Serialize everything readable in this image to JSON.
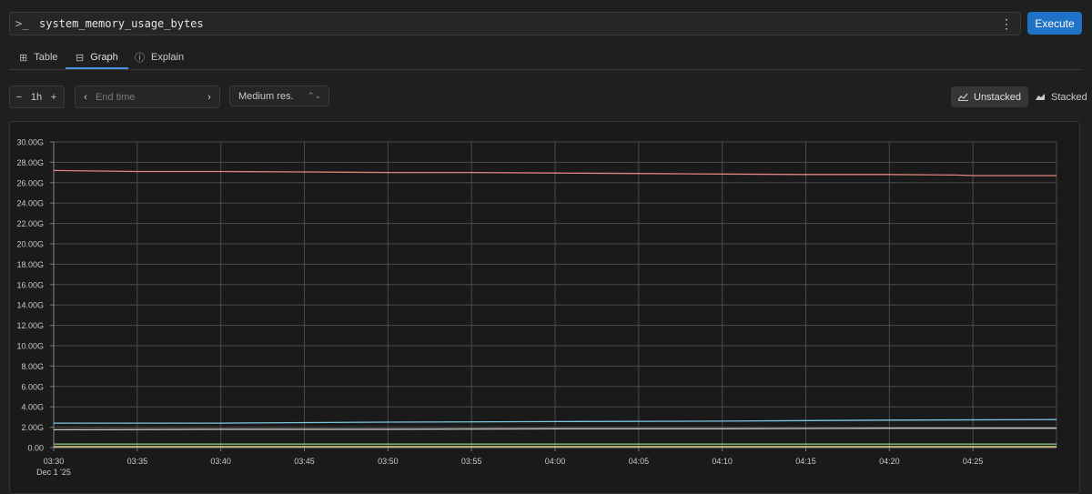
{
  "query": {
    "prompt_icon": "terminal-prompt-icon",
    "prompt_glyph": ">_",
    "expression": "system_memory_usage_bytes",
    "more_icon": "kebab-menu-icon",
    "execute_label": "Execute"
  },
  "tabs": [
    {
      "label": "Table",
      "icon": "table-icon",
      "active": false
    },
    {
      "label": "Graph",
      "icon": "graph-icon",
      "active": true
    },
    {
      "label": "Explain",
      "icon": "info-icon",
      "active": false
    }
  ],
  "controls": {
    "range_minus": "−",
    "range_value": "1h",
    "range_plus": "+",
    "end_prev": "‹",
    "end_time_placeholder": "End time",
    "end_next": "›",
    "resolution": "Medium res.",
    "unstacked_label": "Unstacked",
    "stacked_label": "Stacked",
    "selected_mode": "Unstacked"
  },
  "colors": {
    "accent": "#1f72c7",
    "grid": "#4a4a4a"
  },
  "chart_data": {
    "type": "line",
    "ylim": [
      0,
      30
    ],
    "yticks": [
      "0.00",
      "2.00G",
      "4.00G",
      "6.00G",
      "8.00G",
      "10.00G",
      "12.00G",
      "14.00G",
      "16.00G",
      "18.00G",
      "20.00G",
      "22.00G",
      "24.00G",
      "26.00G",
      "28.00G",
      "30.00G"
    ],
    "xlim": [
      0,
      60
    ],
    "xticks": [
      {
        "t": 0,
        "label": "03:30"
      },
      {
        "t": 5,
        "label": "03:35"
      },
      {
        "t": 10,
        "label": "03:40"
      },
      {
        "t": 15,
        "label": "03:45"
      },
      {
        "t": 20,
        "label": "03:50"
      },
      {
        "t": 25,
        "label": "03:55"
      },
      {
        "t": 30,
        "label": "04:00"
      },
      {
        "t": 35,
        "label": "04:05"
      },
      {
        "t": 40,
        "label": "04:10"
      },
      {
        "t": 45,
        "label": "04:15"
      },
      {
        "t": 50,
        "label": "04:20"
      },
      {
        "t": 55,
        "label": "04:25"
      }
    ],
    "date_label": "Dec 1 '25",
    "series": [
      {
        "color": "#e0837c",
        "x": [
          0,
          5,
          10,
          15,
          20,
          25,
          30,
          35,
          40,
          45,
          50,
          54,
          55,
          60
        ],
        "y": [
          27.2,
          27.1,
          27.1,
          27.05,
          27.0,
          27.0,
          26.95,
          26.9,
          26.85,
          26.8,
          26.8,
          26.75,
          26.7,
          26.7
        ]
      },
      {
        "color": "#7cc7e0",
        "x": [
          0,
          10,
          20,
          30,
          40,
          50,
          60
        ],
        "y": [
          2.4,
          2.4,
          2.5,
          2.55,
          2.6,
          2.7,
          2.75
        ]
      },
      {
        "color": "#c8c8c8",
        "x": [
          0,
          10,
          20,
          30,
          40,
          50,
          60
        ],
        "y": [
          1.75,
          1.8,
          1.8,
          1.85,
          1.85,
          1.9,
          1.9
        ]
      },
      {
        "color": "#8fd18b",
        "x": [
          0,
          30,
          60
        ],
        "y": [
          0.35,
          0.35,
          0.35
        ]
      },
      {
        "color": "#e6d97a",
        "x": [
          0,
          30,
          60
        ],
        "y": [
          0.1,
          0.1,
          0.1
        ]
      }
    ]
  }
}
